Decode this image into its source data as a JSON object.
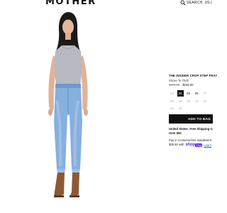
{
  "header": {
    "logo": "MOTHER",
    "search_label": "SEARCH",
    "locale": "US ("
  },
  "product": {
    "title": "THE INSIDER CROP STEP FRAY",
    "color": "Shove To Thrill",
    "original_price": "$220.00",
    "sale_price": "$159.00"
  },
  "sizes": {
    "rows": [
      [
        {
          "label": "23",
          "available": false,
          "selected": false
        },
        {
          "label": "24",
          "available": true,
          "selected": true
        },
        {
          "label": "25",
          "available": true,
          "selected": false
        },
        {
          "label": "26",
          "available": true,
          "selected": false
        },
        {
          "label": "27",
          "available": false,
          "selected": false
        }
      ],
      [
        {
          "label": "28",
          "available": false,
          "selected": false
        },
        {
          "label": "29",
          "available": false,
          "selected": false
        },
        {
          "label": "30",
          "available": false,
          "selected": false
        },
        {
          "label": "31",
          "available": false,
          "selected": false
        },
        {
          "label": "32",
          "available": false,
          "selected": false
        }
      ],
      [
        {
          "label": "33",
          "available": false,
          "selected": false
        },
        {
          "label": "34",
          "available": false,
          "selected": false
        }
      ]
    ]
  },
  "actions": {
    "add_to_bag": "ADD TO BAG"
  },
  "shipping": {
    "line1": "United States: Free Shipping O",
    "line2": "Over $50"
  },
  "installments": {
    "line1": "Pay in 4 interest-free installment",
    "amount": "$39.50 with",
    "shop_label": "shop",
    "pay_label": "Pay",
    "learn_more": "Learn"
  },
  "colors": {
    "brand_black": "#111111",
    "shoppay_purple": "#5a31f4",
    "unavailable_gray": "#b3b3b3"
  }
}
